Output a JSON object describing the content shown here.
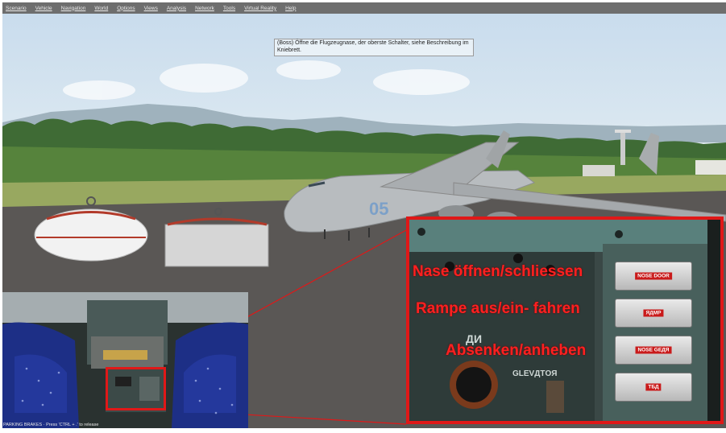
{
  "menu": [
    "Scenario",
    "Vehicle",
    "Navigation",
    "World",
    "Options",
    "Views",
    "Analysis",
    "Network",
    "Tools",
    "Virtual Reality",
    "Help"
  ],
  "hint_text": "(Boss) Öffne die Flugzeugnase, der oberste Schalter, siehe Beschreibung im Kniebrett.",
  "aircraft_tail_number": "05",
  "callouts": {
    "nose": "Nase öffnen/schliessen",
    "ramp": "Rampe aus/ein- fahren",
    "lower": "Absenken/anheben"
  },
  "panel": {
    "switch_labels": [
      "NOSE DOOR",
      "ЯДМР",
      "NOSE GEДЯ",
      "TБД"
    ],
    "label_di": "ДИ",
    "label_glevator": "GLEVДТOЯ"
  },
  "status_text": "PARKING BRAKES · Press 'CTRL + .' to release",
  "colors": {
    "callout_red": "#e01818",
    "menubar": "#6e6e6e"
  }
}
